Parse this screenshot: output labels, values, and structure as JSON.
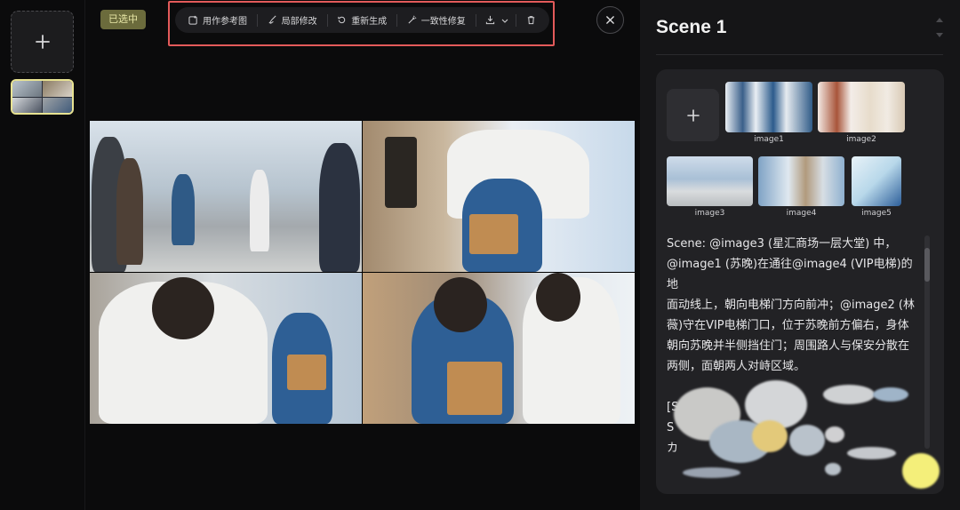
{
  "left_rail": {
    "add_icon": "plus-icon"
  },
  "canvas": {
    "selected_badge": "已选中",
    "toolbar": {
      "items": [
        {
          "label": "用作参考图",
          "icon": "reference-image-icon"
        },
        {
          "label": "局部修改",
          "icon": "brush-icon"
        },
        {
          "label": "重新生成",
          "icon": "regenerate-icon"
        },
        {
          "label": "一致性修复",
          "icon": "wand-icon"
        }
      ],
      "download_icon": "download-icon",
      "more_icon": "chevron-down-icon",
      "delete_icon": "trash-icon"
    },
    "close_icon": "close-icon",
    "storyboard_panels": 4
  },
  "right_panel": {
    "scene_title": "Scene 1",
    "references": [
      {
        "label": "image1"
      },
      {
        "label": "image2"
      },
      {
        "label": "image3"
      },
      {
        "label": "image4"
      },
      {
        "label": "image5"
      }
    ],
    "prompt_lines": [
      "Scene: @image3 (星汇商场一层大堂) 中，",
      "@image1 (苏晚)在通往@image4 (VIP电梯)的地",
      "面动线上，朝向电梯门方向前冲；@image2 (林",
      "薇)守在VIP电梯门口，位于苏晚前方偏右，身体",
      "朝向苏晚并半侧挡住门；周围路人与保安分散在",
      "两侧，面朝两人对峙区域。"
    ],
    "prompt_cut_lines": [
      "[S",
      "S",
      "カ"
    ]
  }
}
